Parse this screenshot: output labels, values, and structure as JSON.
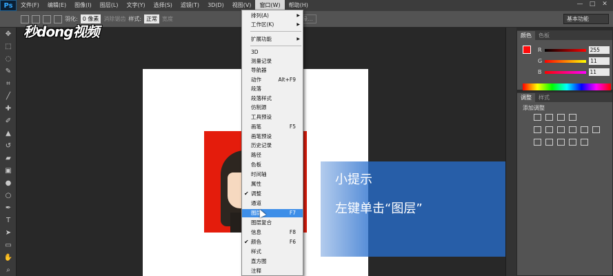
{
  "menubar": {
    "logo": "Ps",
    "items": [
      "文件(F)",
      "编辑(E)",
      "图像(I)",
      "图层(L)",
      "文字(Y)",
      "选择(S)",
      "滤镜(T)",
      "3D(D)",
      "视图(V)",
      "窗口(W)",
      "帮助(H)"
    ],
    "active_index": 9,
    "window_buttons": [
      "—",
      "□",
      "✕"
    ]
  },
  "options": {
    "feather_label": "羽化:",
    "feather_value": "0 像素",
    "antialias_label": "消除锯齿",
    "style_label": "样式:",
    "style_value": "正常",
    "width_label": "宽度",
    "refine_edge": "调整边缘...",
    "workspace": "基本功能"
  },
  "watermark": "秒dong视频",
  "hint": {
    "title": "小提示",
    "text": "左键单击“图层”"
  },
  "window_menu": {
    "items": [
      {
        "label": "排列(A)",
        "arrow": true
      },
      {
        "label": "工作区(K)",
        "arrow": true
      },
      {
        "label": "扩展功能",
        "arrow": true
      },
      {
        "label": "3D"
      },
      {
        "label": "测量记录"
      },
      {
        "label": "导航器"
      },
      {
        "label": "动作",
        "shortcut": "Alt+F9"
      },
      {
        "label": "段落"
      },
      {
        "label": "段落样式"
      },
      {
        "label": "仿制源"
      },
      {
        "label": "工具预设"
      },
      {
        "label": "画笔",
        "shortcut": "F5"
      },
      {
        "label": "画笔预设"
      },
      {
        "label": "历史记录"
      },
      {
        "label": "路径"
      },
      {
        "label": "色板"
      },
      {
        "label": "时间轴"
      },
      {
        "label": "属性"
      },
      {
        "label": "调整",
        "checked": true
      },
      {
        "label": "通道"
      },
      {
        "label": "图层",
        "shortcut": "F7",
        "selected": true
      },
      {
        "label": "图层复合"
      },
      {
        "label": "信息",
        "shortcut": "F8"
      },
      {
        "label": "颜色",
        "shortcut": "F6",
        "checked": true
      },
      {
        "label": "样式"
      },
      {
        "label": "直方图"
      },
      {
        "label": "注释"
      }
    ]
  },
  "color_panel": {
    "tabs": [
      "颜色",
      "色板"
    ],
    "channels": [
      {
        "name": "R",
        "value": "255"
      },
      {
        "name": "G",
        "value": "11"
      },
      {
        "name": "B",
        "value": "11"
      }
    ],
    "foreground": "#ff0b0b"
  },
  "adjust_panel": {
    "tabs": [
      "调整",
      "样式"
    ],
    "heading": "添加调整"
  },
  "colors": {
    "accent": "#3d8ee8",
    "hint_bg": "#286ecd",
    "layer_red": "#e41c0c"
  }
}
